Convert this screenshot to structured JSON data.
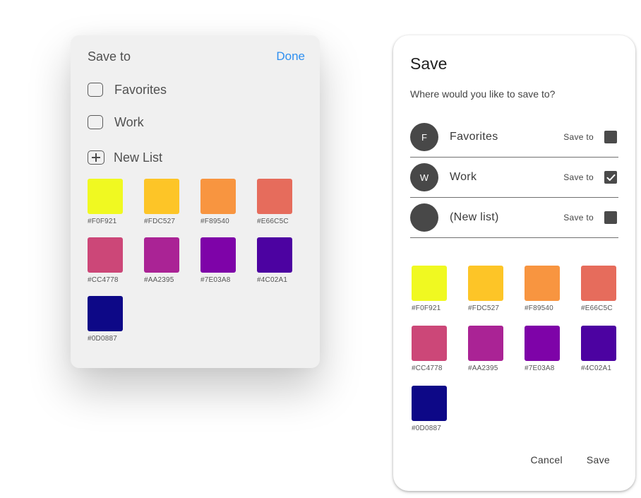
{
  "left_panel": {
    "title": "Save to",
    "done_label": "Done",
    "lists": [
      {
        "label": "Favorites",
        "checked": false
      },
      {
        "label": "Work",
        "checked": false
      }
    ],
    "new_list_label": "New List",
    "swatches": [
      {
        "hex": "#F0F921",
        "label": "#F0F921"
      },
      {
        "hex": "#FDC527",
        "label": "#FDC527"
      },
      {
        "hex": "#F89540",
        "label": "#F89540"
      },
      {
        "hex": "#E66C5C",
        "label": "#E66C5C"
      },
      {
        "hex": "#CC4778",
        "label": "#CC4778"
      },
      {
        "hex": "#AA2395",
        "label": "#AA2395"
      },
      {
        "hex": "#7E03A8",
        "label": "#7E03A8"
      },
      {
        "hex": "#4C02A1",
        "label": "#4C02A1"
      },
      {
        "hex": "#0D0887",
        "label": "#0D0887"
      }
    ],
    "accent_color": "#2E8FF0"
  },
  "right_panel": {
    "title": "Save",
    "subtitle": "Where would you like to save to?",
    "lists": [
      {
        "initial": "F",
        "label": "Favorites",
        "save_to_label": "Save to",
        "checked": false
      },
      {
        "initial": "W",
        "label": "Work",
        "save_to_label": "Save to",
        "checked": true
      },
      {
        "initial": "",
        "label": "(New list)",
        "save_to_label": "Save to",
        "checked": false
      }
    ],
    "swatches": [
      {
        "hex": "#F0F921",
        "label": "#F0F921"
      },
      {
        "hex": "#FDC527",
        "label": "#FDC527"
      },
      {
        "hex": "#F89540",
        "label": "#F89540"
      },
      {
        "hex": "#E66C5C",
        "label": "#E66C5C"
      },
      {
        "hex": "#CC4778",
        "label": "#CC4778"
      },
      {
        "hex": "#AA2395",
        "label": "#AA2395"
      },
      {
        "hex": "#7E03A8",
        "label": "#7E03A8"
      },
      {
        "hex": "#4C02A1",
        "label": "#4C02A1"
      },
      {
        "hex": "#0D0887",
        "label": "#0D0887"
      }
    ],
    "cancel_label": "Cancel",
    "save_label": "Save"
  }
}
